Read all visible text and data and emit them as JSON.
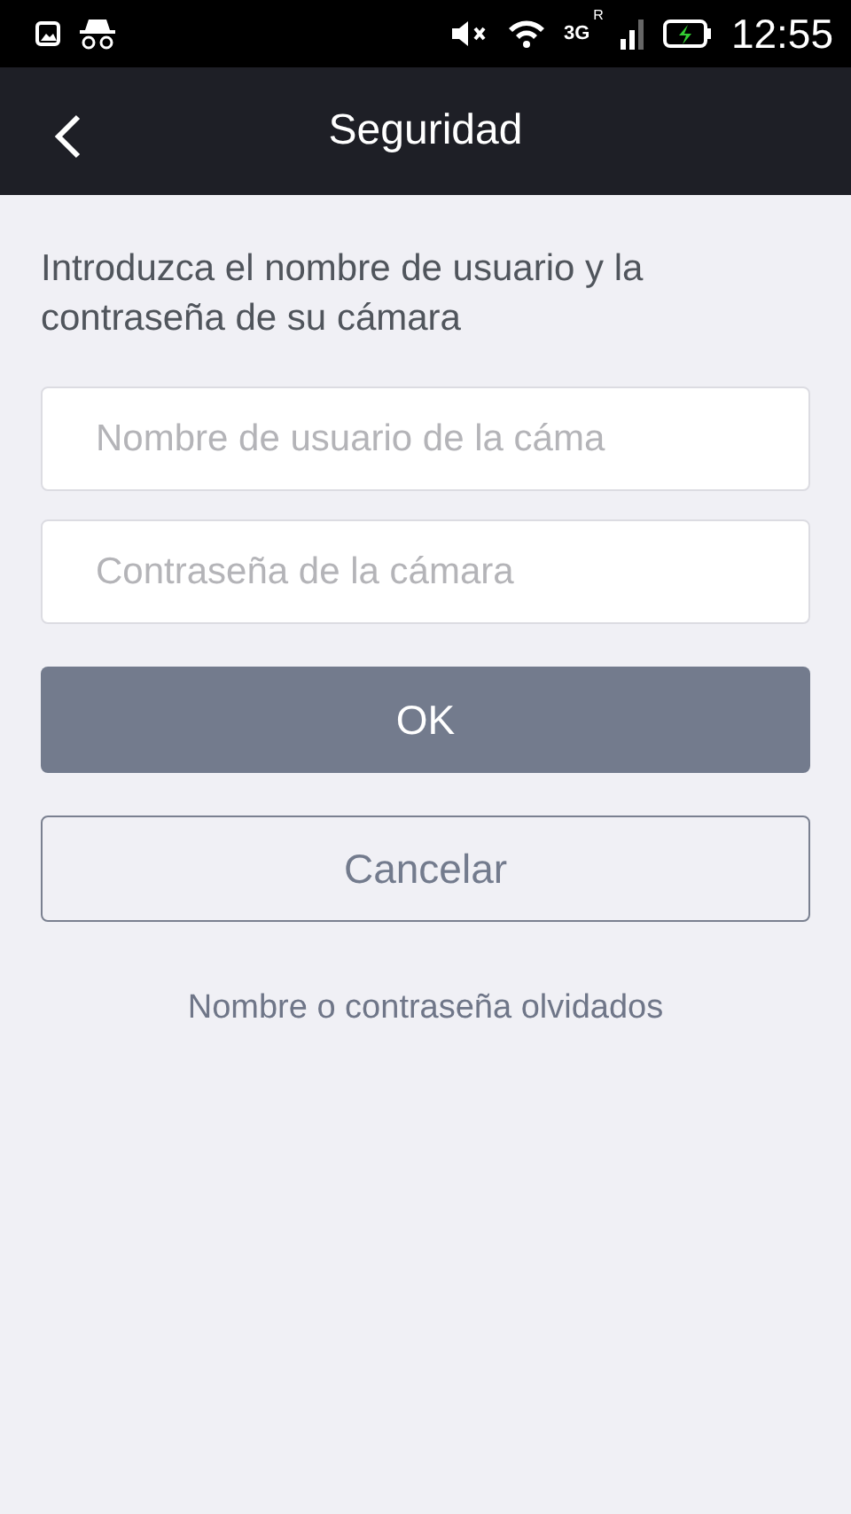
{
  "status_bar": {
    "network": "3G",
    "roaming": "R",
    "time": "12:55"
  },
  "header": {
    "title": "Seguridad"
  },
  "instructions": "Introduzca el nombre de usuario y la contraseña de su cámara",
  "fields": [
    {
      "placeholder": "Nombre de usuario de la cáma"
    },
    {
      "placeholder": "Contraseña de la cámara"
    }
  ],
  "buttons": [
    {
      "label": "OK",
      "kind": "primary"
    },
    {
      "label": "Cancelar",
      "kind": "outline"
    }
  ],
  "forgot_link": "Nombre o contraseña olvidados"
}
